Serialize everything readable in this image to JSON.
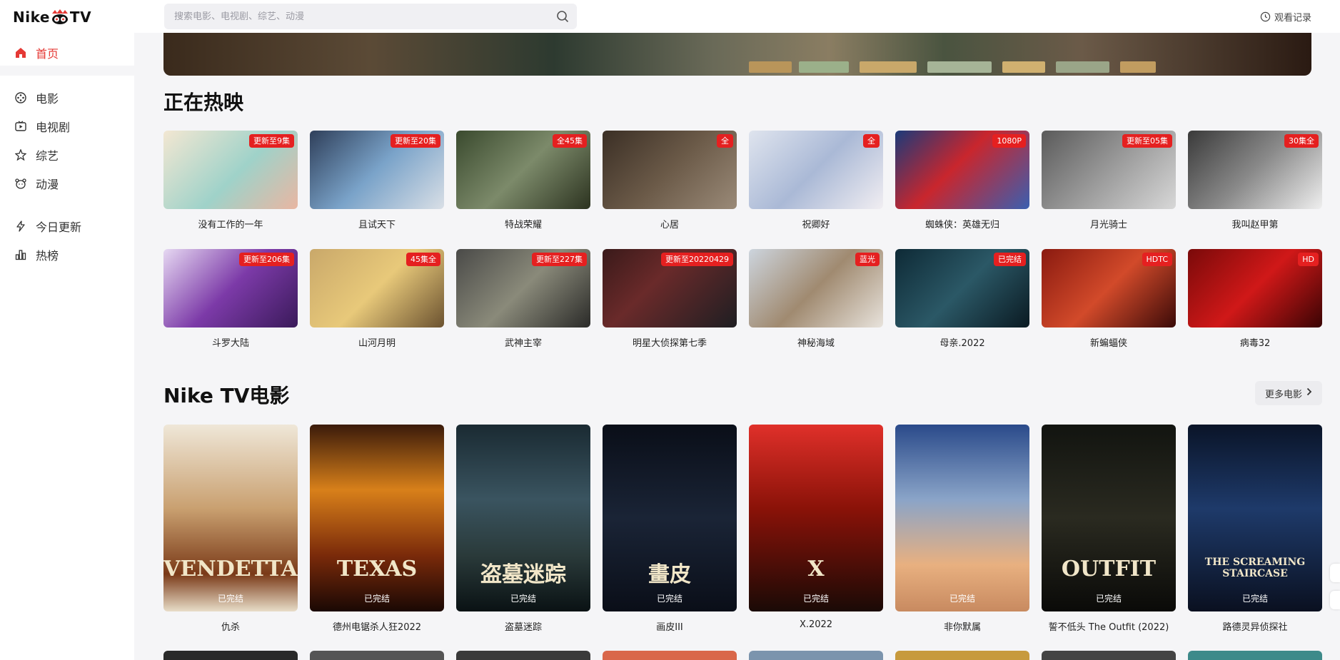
{
  "brand": {
    "logo_left": "Nike",
    "logo_right": "TV"
  },
  "nav": {
    "home": "首页",
    "movies": "电影",
    "tv": "电视剧",
    "variety": "综艺",
    "anime": "动漫",
    "today": "今日更新",
    "hot": "热榜"
  },
  "search": {
    "placeholder": "搜索电影、电视剧、综艺、动漫"
  },
  "header": {
    "history": "观看记录"
  },
  "now_playing": {
    "title": "正在热映",
    "items": [
      {
        "title": "没有工作的一年",
        "tag": "更新至9集"
      },
      {
        "title": "且试天下",
        "tag": "更新至20集"
      },
      {
        "title": "特战荣耀",
        "tag": "全45集"
      },
      {
        "title": "心居",
        "tag": "全"
      },
      {
        "title": "祝卿好",
        "tag": "全"
      },
      {
        "title": "蜘蛛侠：英雄无归",
        "tag": "1080P"
      },
      {
        "title": "月光骑士",
        "tag": "更新至05集"
      },
      {
        "title": "我叫赵甲第",
        "tag": "30集全"
      },
      {
        "title": "斗罗大陆",
        "tag": "更新至206集"
      },
      {
        "title": "山河月明",
        "tag": "45集全"
      },
      {
        "title": "武神主宰",
        "tag": "更新至227集"
      },
      {
        "title": "明星大侦探第七季",
        "tag": "更新至20220429"
      },
      {
        "title": "神秘海域",
        "tag": "蓝光"
      },
      {
        "title": "母亲.2022",
        "tag": "已完结"
      },
      {
        "title": "新蝙蝠侠",
        "tag": "HDTC"
      },
      {
        "title": "病毒32",
        "tag": "HD"
      }
    ]
  },
  "movies": {
    "title": "Nike TV电影",
    "more": "更多电影",
    "items": [
      {
        "title": "仇杀",
        "status": "已完结",
        "poster_text": "VENDETTA"
      },
      {
        "title": "德州电锯杀人狂2022",
        "status": "已完结",
        "poster_text": "TEXAS"
      },
      {
        "title": "盗墓迷踪",
        "status": "已完结",
        "poster_text": "盗墓迷踪"
      },
      {
        "title": "画皮III",
        "status": "已完结",
        "poster_text": "畫皮"
      },
      {
        "title": "X.2022",
        "status": "已完结",
        "poster_text": "X"
      },
      {
        "title": "非你默属",
        "status": "已完结",
        "poster_text": ""
      },
      {
        "title": "誓不低头 The Outfit (2022)",
        "status": "已完结",
        "poster_text": "OUTFIT"
      },
      {
        "title": "路德灵异侦探社",
        "status": "已完结",
        "poster_text": "THE SCREAMING STAIRCASE"
      }
    ]
  },
  "colors": {
    "accent": "#e53935",
    "tag_bg": "#e52020",
    "page_bg": "#f5f5f7"
  }
}
